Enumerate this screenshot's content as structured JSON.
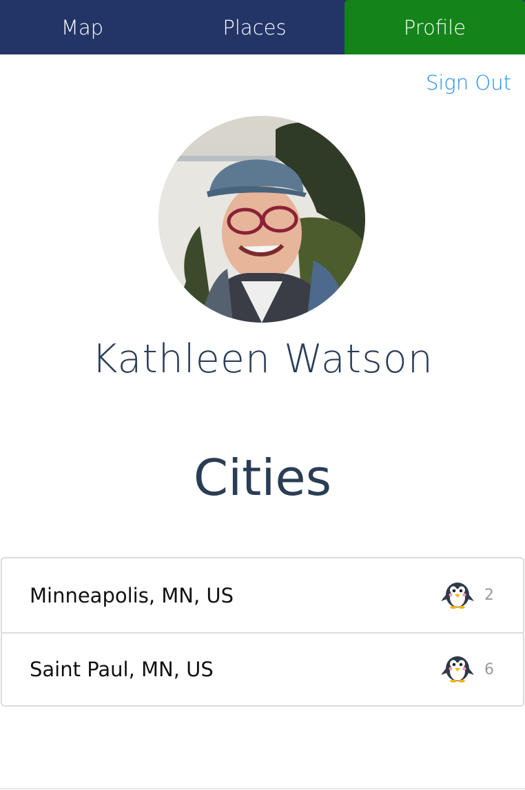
{
  "nav": {
    "tabs": [
      {
        "label": "Map"
      },
      {
        "label": "Places"
      },
      {
        "label": "Profile"
      }
    ],
    "active_tab": "Profile",
    "bar_color": "#233567",
    "active_color": "#14841a"
  },
  "account": {
    "sign_out_label": "Sign Out"
  },
  "profile": {
    "name": "Kathleen Watson",
    "avatar_icon": "profile-photo"
  },
  "cities": {
    "title": "Cities",
    "items": [
      {
        "name": "Minneapolis, MN, US",
        "count": "2",
        "icon": "penguin-icon"
      },
      {
        "name": "Saint Paul, MN, US",
        "count": "6",
        "icon": "penguin-icon"
      }
    ]
  },
  "colors": {
    "link": "#1e8df0",
    "heading": "#2a3d55"
  }
}
